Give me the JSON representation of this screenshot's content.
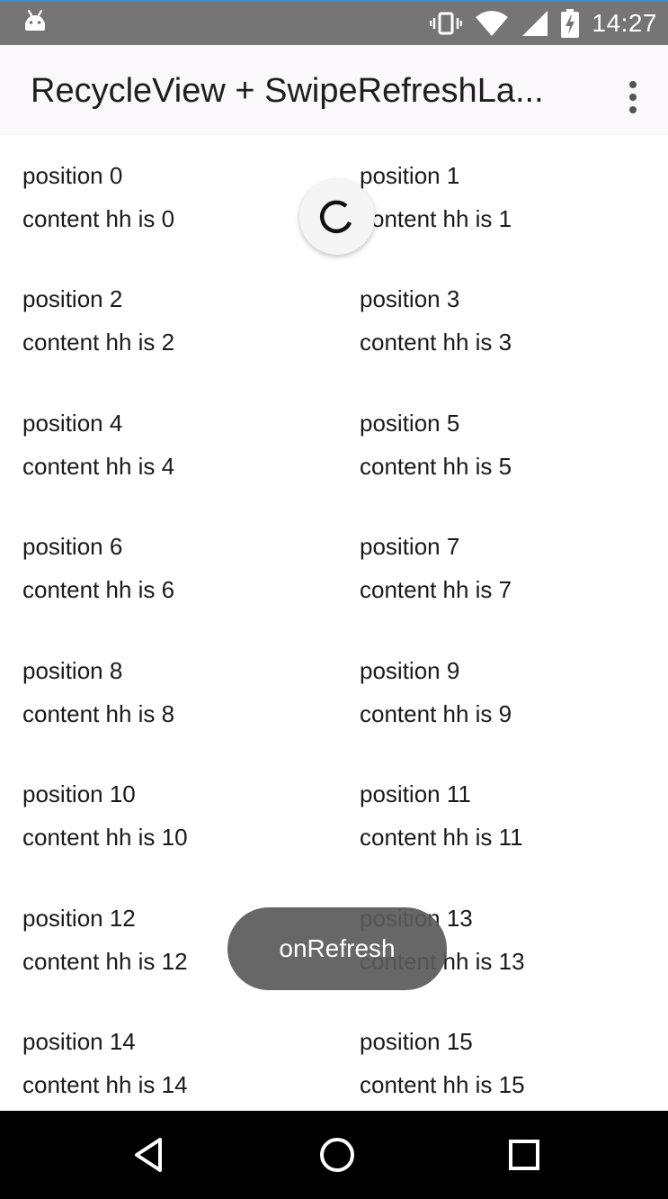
{
  "status_bar": {
    "time": "14:27",
    "icons": [
      "android-icon",
      "vibrate-icon",
      "wifi-icon",
      "cellular-signal-icon",
      "battery-charging-icon"
    ]
  },
  "app_bar": {
    "title": "RecycleView + SwipeRefreshLa...",
    "menu_icon": "overflow-menu-icon"
  },
  "list": {
    "items": [
      {
        "position": "position 0",
        "content": "content hh is 0"
      },
      {
        "position": "position 1",
        "content": "content hh is 1"
      },
      {
        "position": "position 2",
        "content": "content hh is 2"
      },
      {
        "position": "position 3",
        "content": "content hh is 3"
      },
      {
        "position": "position 4",
        "content": "content hh is 4"
      },
      {
        "position": "position 5",
        "content": "content hh is 5"
      },
      {
        "position": "position 6",
        "content": "content hh is 6"
      },
      {
        "position": "position 7",
        "content": "content hh is 7"
      },
      {
        "position": "position 8",
        "content": "content hh is 8"
      },
      {
        "position": "position 9",
        "content": "content hh is 9"
      },
      {
        "position": "position 10",
        "content": "content hh is 10"
      },
      {
        "position": "position 11",
        "content": "content hh is 11"
      },
      {
        "position": "position 12",
        "content": "content hh is 12"
      },
      {
        "position": "position 13",
        "content": "content hh is 13"
      },
      {
        "position": "position 14",
        "content": "content hh is 14"
      },
      {
        "position": "position 15",
        "content": "content hh is 15"
      }
    ]
  },
  "toast": {
    "message": "onRefresh"
  },
  "nav_bar": {
    "icons": [
      "back-icon",
      "home-icon",
      "recents-icon"
    ]
  },
  "colors": {
    "status_bar": "#757575",
    "app_bar": "#fbf8fb",
    "toast": "#5a5a5a",
    "nav_bar": "#000000"
  }
}
